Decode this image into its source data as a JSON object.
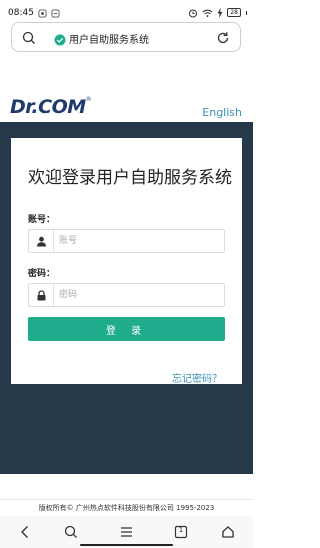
{
  "status_bar": {
    "time": "08:45",
    "battery": "28"
  },
  "address_bar": {
    "url_text": "用户自助服务系统"
  },
  "header": {
    "logo_text": "Dr.COM",
    "logo_mark": "®",
    "language_link": "English"
  },
  "login": {
    "title": "欢迎登录用户自助服务系统",
    "account_label": "账号：",
    "account_placeholder": "账号",
    "password_label": "密码：",
    "password_placeholder": "密码",
    "login_button": "登 录",
    "forgot_link": "忘记密码？"
  },
  "footer": {
    "copyright": "版权所有© 广州热点软件科技股份有限公司 1995-2023"
  },
  "bottom_nav": {
    "tab_count": "1"
  },
  "colors": {
    "accent": "#1fac8d",
    "panel": "#26394a",
    "link": "#3a8fb7",
    "logo": "#1e3a6e"
  }
}
